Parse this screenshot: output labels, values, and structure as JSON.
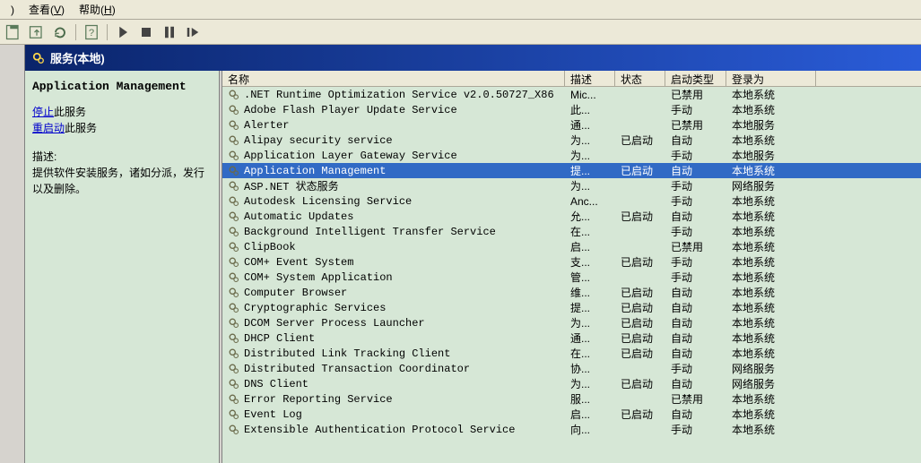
{
  "menu": {
    "view": "查看(V)",
    "help": "帮助(H)",
    "extra": ")"
  },
  "header": {
    "title": "服务(本地)"
  },
  "left": {
    "title": "Application Management",
    "stop_link": "停止",
    "stop_suffix": "此服务",
    "restart_link": "重启动",
    "restart_suffix": "此服务",
    "desc_label": "描述:",
    "desc_text": "提供软件安装服务，诸如分派，发行以及删除。"
  },
  "columns": {
    "name": "名称",
    "desc": "描述",
    "state": "状态",
    "start": "启动类型",
    "logon": "登录为"
  },
  "services": [
    {
      "name": ".NET Runtime Optimization Service v2.0.50727_X86",
      "desc": "Mic...",
      "state": "",
      "start": "已禁用",
      "logon": "本地系统",
      "sel": false
    },
    {
      "name": "Adobe Flash Player Update Service",
      "desc": "此...",
      "state": "",
      "start": "手动",
      "logon": "本地系统",
      "sel": false
    },
    {
      "name": "Alerter",
      "desc": "通...",
      "state": "",
      "start": "已禁用",
      "logon": "本地服务",
      "sel": false
    },
    {
      "name": "Alipay security service",
      "desc": "为...",
      "state": "已启动",
      "start": "自动",
      "logon": "本地系统",
      "sel": false
    },
    {
      "name": "Application Layer Gateway Service",
      "desc": "为...",
      "state": "",
      "start": "手动",
      "logon": "本地服务",
      "sel": false
    },
    {
      "name": "Application Management",
      "desc": "提...",
      "state": "已启动",
      "start": "自动",
      "logon": "本地系统",
      "sel": true
    },
    {
      "name": "ASP.NET 状态服务",
      "desc": "为...",
      "state": "",
      "start": "手动",
      "logon": "网络服务",
      "sel": false
    },
    {
      "name": "Autodesk Licensing Service",
      "desc": "Anc...",
      "state": "",
      "start": "手动",
      "logon": "本地系统",
      "sel": false
    },
    {
      "name": "Automatic Updates",
      "desc": "允...",
      "state": "已启动",
      "start": "自动",
      "logon": "本地系统",
      "sel": false
    },
    {
      "name": "Background Intelligent Transfer Service",
      "desc": "在...",
      "state": "",
      "start": "手动",
      "logon": "本地系统",
      "sel": false
    },
    {
      "name": "ClipBook",
      "desc": "启...",
      "state": "",
      "start": "已禁用",
      "logon": "本地系统",
      "sel": false
    },
    {
      "name": "COM+ Event System",
      "desc": "支...",
      "state": "已启动",
      "start": "手动",
      "logon": "本地系统",
      "sel": false
    },
    {
      "name": "COM+ System Application",
      "desc": "管...",
      "state": "",
      "start": "手动",
      "logon": "本地系统",
      "sel": false
    },
    {
      "name": "Computer Browser",
      "desc": "维...",
      "state": "已启动",
      "start": "自动",
      "logon": "本地系统",
      "sel": false
    },
    {
      "name": "Cryptographic Services",
      "desc": "提...",
      "state": "已启动",
      "start": "自动",
      "logon": "本地系统",
      "sel": false
    },
    {
      "name": "DCOM Server Process Launcher",
      "desc": "为...",
      "state": "已启动",
      "start": "自动",
      "logon": "本地系统",
      "sel": false
    },
    {
      "name": "DHCP Client",
      "desc": "通...",
      "state": "已启动",
      "start": "自动",
      "logon": "本地系统",
      "sel": false
    },
    {
      "name": "Distributed Link Tracking Client",
      "desc": "在...",
      "state": "已启动",
      "start": "自动",
      "logon": "本地系统",
      "sel": false
    },
    {
      "name": "Distributed Transaction Coordinator",
      "desc": "协...",
      "state": "",
      "start": "手动",
      "logon": "网络服务",
      "sel": false
    },
    {
      "name": "DNS Client",
      "desc": "为...",
      "state": "已启动",
      "start": "自动",
      "logon": "网络服务",
      "sel": false
    },
    {
      "name": "Error Reporting Service",
      "desc": "服...",
      "state": "",
      "start": "已禁用",
      "logon": "本地系统",
      "sel": false
    },
    {
      "name": "Event Log",
      "desc": "启...",
      "state": "已启动",
      "start": "自动",
      "logon": "本地系统",
      "sel": false
    },
    {
      "name": "Extensible Authentication Protocol Service",
      "desc": "向...",
      "state": "",
      "start": "手动",
      "logon": "本地系统",
      "sel": false
    }
  ]
}
